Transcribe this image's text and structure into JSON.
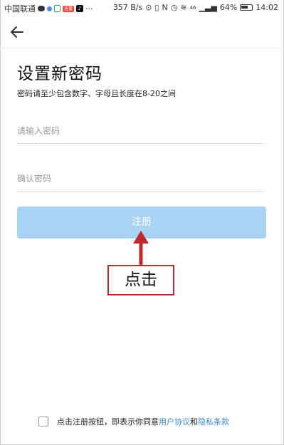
{
  "status_bar": {
    "carrier": "中国联通",
    "badge": "迅雷",
    "speed": "357 B/s",
    "signal": "46",
    "battery": "64%",
    "time": "14:02"
  },
  "nav": {
    "back_icon": "arrow-left-icon"
  },
  "page": {
    "title": "设置新密码",
    "hint": "密码请至少包含数字、字母且长度在8-20之间"
  },
  "form": {
    "password_placeholder": "请输入密码",
    "confirm_placeholder": "确认密码",
    "password_value": "",
    "confirm_value": "",
    "register_label": "注册"
  },
  "annotation": {
    "label": "点击",
    "color": "#c2272d"
  },
  "agreement": {
    "prefix": "点击注册按钮，即表示你同意",
    "user_agreement": "用户协议",
    "and": "和",
    "privacy_policy": "隐私条款",
    "link_color": "#3b88d8"
  },
  "colors": {
    "button_bg": "#a8d3f3",
    "accent": "#3b88d8"
  }
}
